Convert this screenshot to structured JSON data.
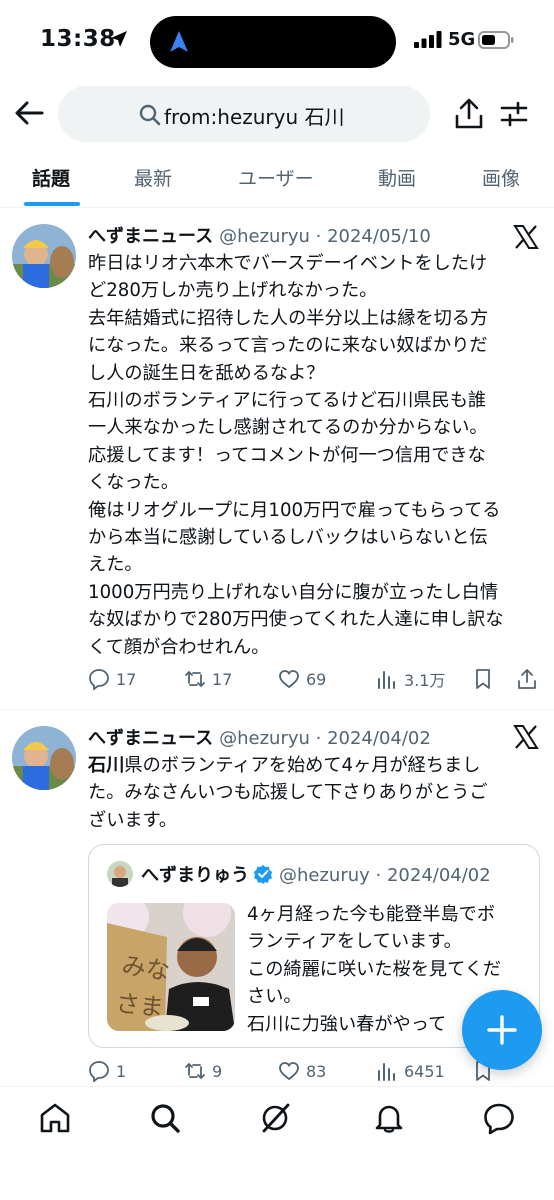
{
  "status_bar": {
    "time": "13:38",
    "network": "5G"
  },
  "search": {
    "query": "from:hezuryu 石川"
  },
  "tabs": [
    {
      "label": "話題",
      "active": true
    },
    {
      "label": "最新",
      "active": false
    },
    {
      "label": "ユーザー",
      "active": false
    },
    {
      "label": "動画",
      "active": false
    },
    {
      "label": "画像",
      "active": false
    }
  ],
  "tweets": [
    {
      "name": "へずまニュース",
      "meta": "@hezuryu · 2024/05/10",
      "lines": [
        "昨日はリオ六本木でバースデーイベントをしたけ",
        "ど280万しか売り上げれなかった。",
        "去年結婚式に招待した人の半分以上は縁を切る方",
        "になった。来るって言ったのに来ない奴ばかりだ",
        "し人の誕生日を舐めるなよ？",
        "石川のボランティアに行ってるけど石川県民も誰",
        "一人来なかったし感謝されてるのか分からない。",
        "応援してます！ってコメントが何一つ信用できな",
        "くなった。",
        "俺はリオグループに月100万円で雇ってもらってる",
        "から本当に感謝しているしバックはいらないと伝",
        "えた。",
        "1000万円売り上げれない自分に腹が立ったし白情",
        "な奴ばかりで280万円使ってくれた人達に申し訳な",
        "くて顔が合わせれん。"
      ],
      "replies": "17",
      "retweets": "17",
      "likes": "69",
      "views": "3.1万"
    },
    {
      "name": "へずまニュース",
      "meta": "@hezuryu · 2024/04/02",
      "line1_bold": "石川",
      "line1_rest": "県のボランティアを始めて4ヶ月が経ちまし",
      "line2": "た。みなさんいつも応援して下さりありがとうご",
      "line3": "ざいます。",
      "quote": {
        "name": "へずまりゅう",
        "meta": "@hezuruy · 2024/04/02",
        "lines": [
          "4ヶ月経った今も能登半島でボ",
          "ランティアをしています。",
          "この綺麗に咲いた桜を見てくだ",
          "さい。",
          "石川に力強い春がやって"
        ],
        "image_sign_text": "みなさま"
      },
      "replies": "1",
      "retweets": "9",
      "likes": "83",
      "views": "6451"
    }
  ],
  "colors": {
    "accent": "#1d9bf0",
    "text": "#0f1419",
    "muted": "#536471"
  }
}
